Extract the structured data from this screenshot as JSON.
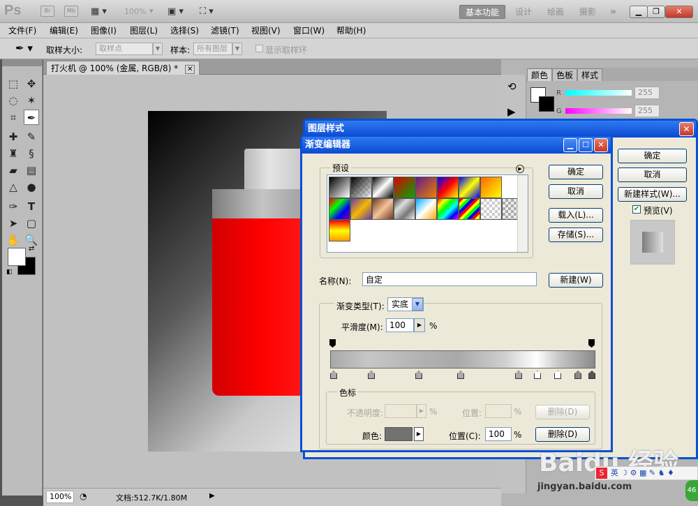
{
  "app": {
    "logo": "Ps",
    "toolbar_icons": [
      "Br",
      "Mb"
    ],
    "zoom_combo": "100%",
    "workspaces": [
      "基本功能",
      "设计",
      "绘画",
      "摄影"
    ],
    "more": "»"
  },
  "menu": [
    "文件(F)",
    "编辑(E)",
    "图像(I)",
    "图层(L)",
    "选择(S)",
    "滤镜(T)",
    "视图(V)",
    "窗口(W)",
    "帮助(H)"
  ],
  "options_bar": {
    "sample_size_label": "取样大小:",
    "sample_size_value": "取样点",
    "sample_label": "样本:",
    "sample_value": "所有图层",
    "show_ring_label": "显示取样环"
  },
  "document": {
    "tab_title": "打火机 @ 100% (金属, RGB/8) *",
    "zoom": "100%",
    "doc_size": "文档:512.7K/1.80M"
  },
  "panels": {
    "tabs": [
      "颜色",
      "色板",
      "样式"
    ],
    "r_label": "R",
    "g_label": "G",
    "r_value": "255",
    "g_value": "255"
  },
  "layer_style": {
    "title": "图层样式",
    "ok": "确定",
    "cancel": "取消",
    "new_style": "新建样式(W)...",
    "preview": "预览(V)"
  },
  "gradient_editor": {
    "title": "渐变编辑器",
    "presets_label": "预设",
    "ok": "确定",
    "cancel": "取消",
    "load": "载入(L)...",
    "save": "存储(S)...",
    "name_label": "名称(N):",
    "name_value": "自定",
    "new": "新建(W)",
    "type_label": "渐变类型(T):",
    "type_value": "实底",
    "smooth_label": "平滑度(M):",
    "smooth_value": "100",
    "smooth_unit": "%",
    "stops_group": "色标",
    "opacity_label": "不透明度:",
    "opacity_unit": "%",
    "location_label": "位置:",
    "location_unit": "%",
    "delete": "删除(D)",
    "color_label": "颜色:",
    "location2_label": "位置(C):",
    "location2_value": "100",
    "location2_unit": "%",
    "delete2": "删除(D)"
  },
  "watermark": {
    "brand": "Baidu 经验",
    "url": "jingyan.baidu.com"
  },
  "taskbar_badge": "46"
}
